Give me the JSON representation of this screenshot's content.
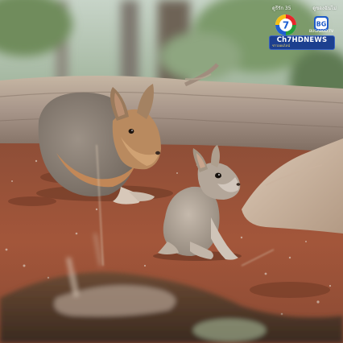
{
  "image": {
    "subject": "Patagonian mara adult and baby on red soil",
    "palette": {
      "soil": "#9a4f33",
      "log": "#a79685",
      "adult_fur": "#8d8276",
      "adult_belly": "#c98a55",
      "baby_fur": "#a89d92",
      "foliage": "#6a8a5a"
    }
  },
  "watermark": {
    "top_left_text": "ดูรีรัก 35",
    "top_right_text": "ดูของฉันไม่",
    "channel_badge_icon": "ch7-logo-icon",
    "channel_badge_label": "7",
    "partner_badge_icon": "bugaboo-logo-icon",
    "partner_badge_label": "BG",
    "partner_caption": "BUGABOO.TV",
    "news_brand": "Ch7HDNEWS",
    "news_sub": "ข่าวออนไลน์",
    "accent_color": "#1c3f8f",
    "highlight_color": "#ffdf5a"
  }
}
